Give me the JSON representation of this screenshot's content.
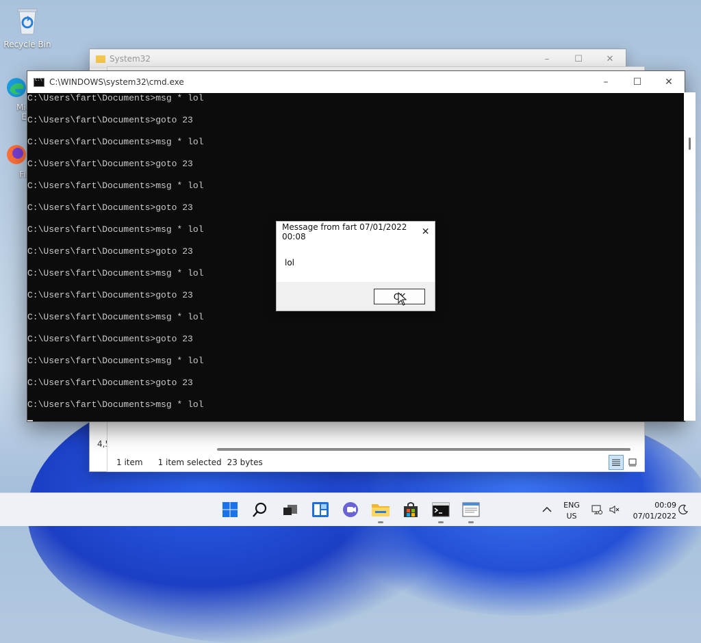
{
  "desktop": {
    "icons": [
      {
        "label": "Recycle Bin",
        "icon": "recycle-bin-icon"
      },
      {
        "label": "Micro Ed",
        "icon": "edge-icon"
      },
      {
        "label": "Fire",
        "icon": "firefox-icon"
      }
    ]
  },
  "explorer": {
    "title": "System32",
    "status_count": "1 item",
    "status_selected": "1 item selected",
    "status_size": "23 bytes",
    "partial_text": "4,5"
  },
  "cmd": {
    "title": "C:\\WINDOWS\\system32\\cmd.exe",
    "lines": [
      "C:\\Users\\fart\\Documents>msg * lol",
      "C:\\Users\\fart\\Documents>goto 23",
      "C:\\Users\\fart\\Documents>msg * lol",
      "C:\\Users\\fart\\Documents>goto 23",
      "C:\\Users\\fart\\Documents>msg * lol",
      "C:\\Users\\fart\\Documents>goto 23",
      "C:\\Users\\fart\\Documents>msg * lol",
      "C:\\Users\\fart\\Documents>goto 23",
      "C:\\Users\\fart\\Documents>msg * lol",
      "C:\\Users\\fart\\Documents>goto 23",
      "C:\\Users\\fart\\Documents>msg * lol",
      "C:\\Users\\fart\\Documents>goto 23",
      "C:\\Users\\fart\\Documents>msg * lol",
      "C:\\Users\\fart\\Documents>goto 23",
      "C:\\Users\\fart\\Documents>msg * lol"
    ]
  },
  "message_box": {
    "title": "Message from fart 07/01/2022 00:08",
    "message": "lol",
    "ok_label": "OK"
  },
  "taskbar": {
    "apps": [
      "start-icon",
      "search-icon",
      "task-view-icon",
      "widgets-icon",
      "teams-chat-icon",
      "file-explorer-icon",
      "store-icon",
      "cmd-icon",
      "notepad-icon"
    ],
    "lang_line1": "ENG",
    "lang_line2": "US",
    "time": "00:09",
    "date": "07/01/2022"
  }
}
